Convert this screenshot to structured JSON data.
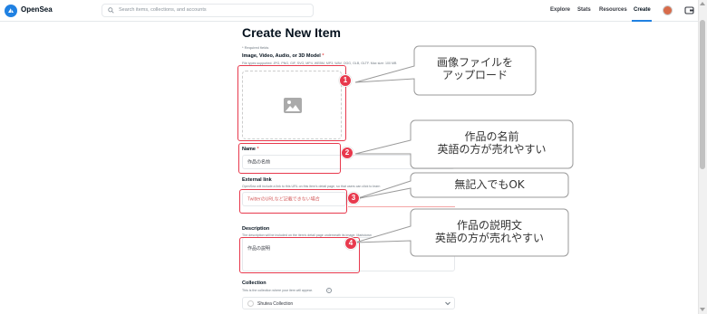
{
  "nav": {
    "brand": "OpenSea",
    "search_placeholder": "Search items, collections, and accounts",
    "links": [
      "Explore",
      "Stats",
      "Resources",
      "Create"
    ]
  },
  "form": {
    "title": "Create New Item",
    "required_note": "* Required fields",
    "media": {
      "label": "Image, Video, Audio, or 3D Model",
      "hint": "File types supported: JPG, PNG, GIF, SVG, MP4, WEBM, MP3, WAV, OGG, GLB, GLTF. Max size: 100 MB"
    },
    "name": {
      "label": "Name",
      "value": "作品の名前"
    },
    "external_link": {
      "label": "External link",
      "hint": "OpenSea will include a link to this URL on this item's detail page, so that users can click to learn",
      "value": "TwitterのURLなど記載できない場合"
    },
    "description": {
      "label": "Description",
      "hint": "The description will be included on the item's detail page underneath its image. Markdown",
      "value": "作品の説明"
    },
    "collection": {
      "label": "Collection",
      "hint": "This is the collection where your item will appear.",
      "selected": "Shutea Collection"
    }
  },
  "annotations": {
    "badges": [
      "1",
      "2",
      "3",
      "4"
    ],
    "callouts": [
      [
        "画像ファイルを",
        "アップロード"
      ],
      [
        "作品の名前",
        "英語の方が売れやすい"
      ],
      [
        "無記入でもOK"
      ],
      [
        "作品の説明文",
        "英語の方が売れやすい"
      ]
    ],
    "color": "#e8394d"
  },
  "colors": {
    "accent": "#2081e2",
    "annotation": "#e8394d"
  }
}
